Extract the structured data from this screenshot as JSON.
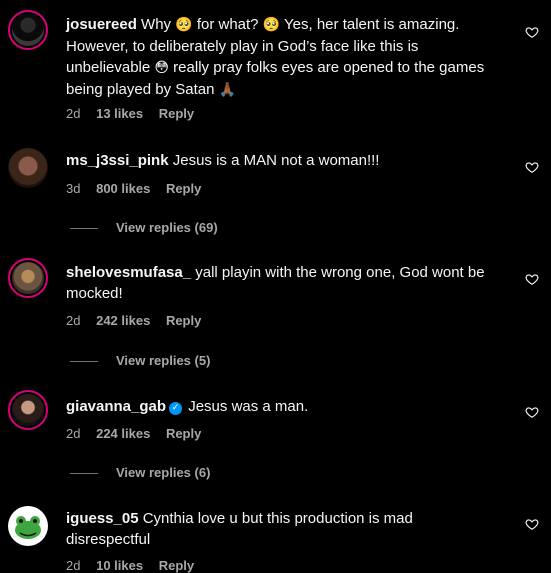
{
  "comments": [
    {
      "username": "josuereed",
      "text_a": " Why ",
      "emoji_a": "🥺",
      "text_b": " for what? ",
      "emoji_b": "🥺",
      "text_c": " Yes, her talent is amazing. However, to deliberately play in God’s face like this is unbelievable ",
      "emoji_c": "😳",
      "text_d": " really pray folks eyes are opened to the games being played by Satan ",
      "emoji_d": "🙏🏾",
      "age": "2d",
      "likes": "13 likes",
      "reply": "Reply"
    },
    {
      "username": "ms_j3ssi_pink",
      "text": " Jesus is a MAN not a woman!!!",
      "age": "3d",
      "likes": "800 likes",
      "reply": "Reply",
      "view_replies": "View replies (69)"
    },
    {
      "username": "shelovesmufasa_",
      "text": " yall playin with the wrong one, God wont be mocked!",
      "age": "2d",
      "likes": "242 likes",
      "reply": "Reply",
      "view_replies": "View replies (5)"
    },
    {
      "username": "giavanna_gab",
      "text": " Jesus was a man.",
      "age": "2d",
      "likes": "224 likes",
      "reply": "Reply",
      "view_replies": "View replies (6)"
    },
    {
      "username": "iguess_05",
      "text": " Cynthia love u but this production is mad disrespectful",
      "age": "2d",
      "likes": "10 likes",
      "reply": "Reply"
    }
  ],
  "icons": {
    "heart": "heart-outline-icon",
    "verified": "verified-badge-icon"
  },
  "colors": {
    "background": "#000000",
    "secondary_text": "#a8a8a8",
    "ring": "#d9007a",
    "verified": "#0095f6"
  }
}
